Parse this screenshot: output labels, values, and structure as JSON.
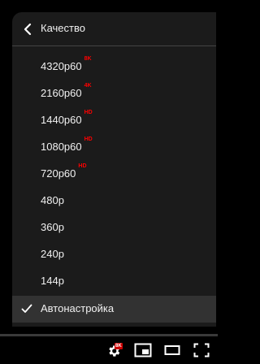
{
  "menu": {
    "title": "Качество",
    "items": [
      {
        "label": "4320p60",
        "badge": "8K"
      },
      {
        "label": "2160p60",
        "badge": "4K"
      },
      {
        "label": "1440p60",
        "badge": "HD"
      },
      {
        "label": "1080p60",
        "badge": "HD"
      },
      {
        "label": "720p60",
        "badge": "HD"
      },
      {
        "label": "480p",
        "badge": ""
      },
      {
        "label": "360p",
        "badge": ""
      },
      {
        "label": "240p",
        "badge": ""
      },
      {
        "label": "144p",
        "badge": ""
      },
      {
        "label": "Автонастройка",
        "badge": ""
      }
    ],
    "selected": "Автонастройка"
  },
  "controls": {
    "settings_badge": "8K"
  },
  "colors": {
    "badge": "#ff0000",
    "menu_bg": "#1c1c1c",
    "text": "#f1f1f1"
  }
}
